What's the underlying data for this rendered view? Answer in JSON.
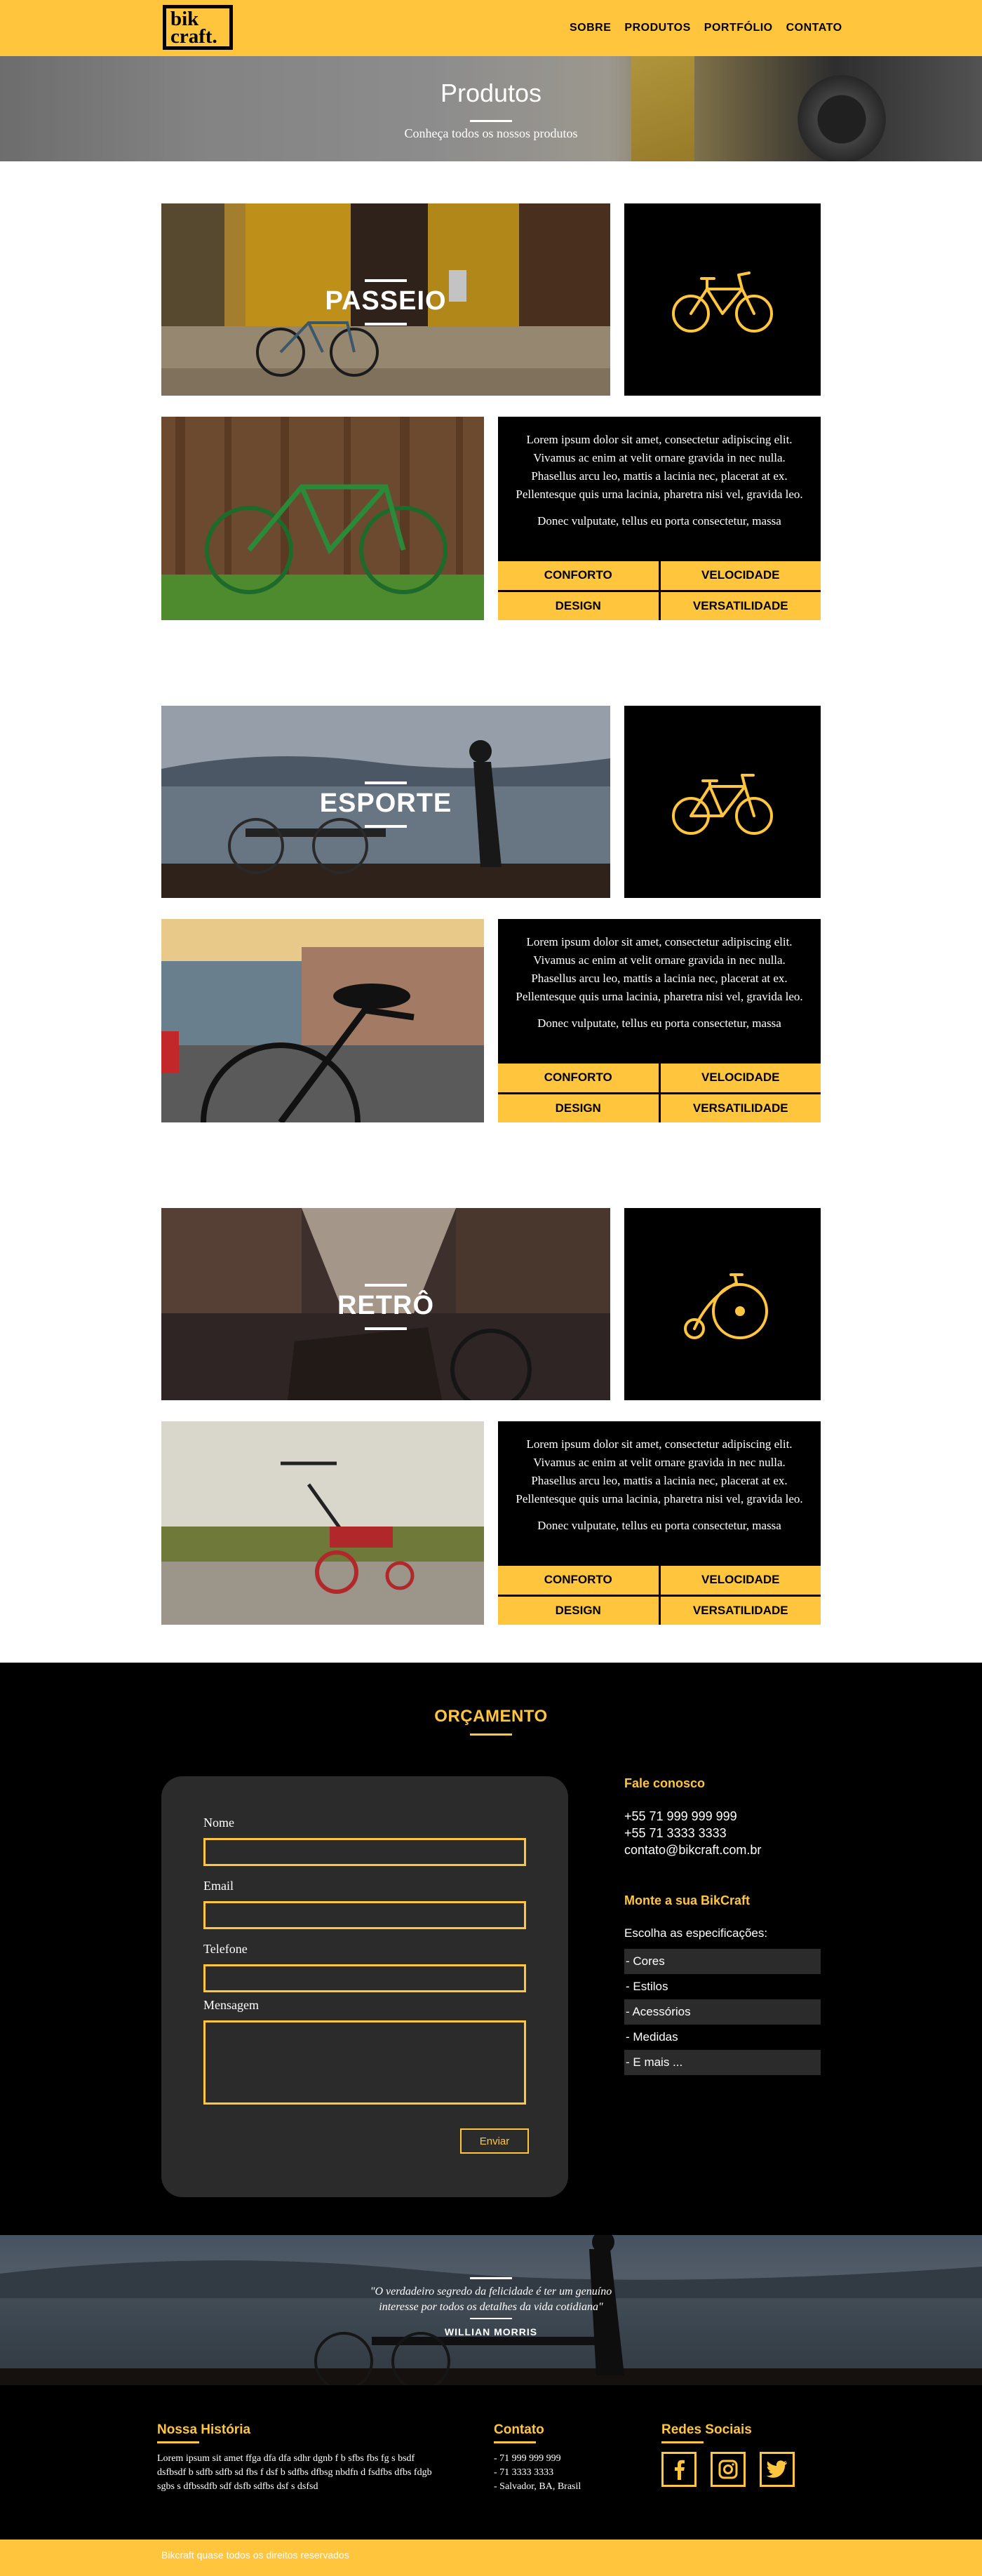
{
  "header": {
    "logo_line1": "bik",
    "logo_line2": "craft.",
    "nav": [
      "SOBRE",
      "PRODUTOS",
      "PORTFÓLIO",
      "CONTATO"
    ]
  },
  "hero": {
    "title": "Produtos",
    "subtitle": "Conheça todos os nossos produtos"
  },
  "products": [
    {
      "name": "PASSEIO",
      "icon": "city-bike-icon",
      "text1": "Lorem ipsum dolor sit amet, consectetur adipiscing elit. Vivamus ac enim at velit ornare gravida in nec nulla. Phasellus arcu leo, mattis a lacinia nec, placerat at ex. Pellentesque quis urna lacinia, pharetra nisi vel, gravida leo.",
      "text2": "Donec vulputate, tellus eu porta consectetur, massa",
      "features": [
        "CONFORTO",
        "VELOCIDADE",
        "DESIGN",
        "VERSATILIDADE"
      ]
    },
    {
      "name": "ESPORTE",
      "icon": "road-bike-icon",
      "text1": "Lorem ipsum dolor sit amet, consectetur adipiscing elit. Vivamus ac enim at velit ornare gravida in nec nulla. Phasellus arcu leo, mattis a lacinia nec, placerat at ex. Pellentesque quis urna lacinia, pharetra nisi vel, gravida leo.",
      "text2": "Donec vulputate, tellus eu porta consectetur, massa",
      "features": [
        "CONFORTO",
        "VELOCIDADE",
        "DESIGN",
        "VERSATILIDADE"
      ]
    },
    {
      "name": "RETRÔ",
      "icon": "penny-farthing-icon",
      "text1": "Lorem ipsum dolor sit amet, consectetur adipiscing elit. Vivamus ac enim at velit ornare gravida in nec nulla. Phasellus arcu leo, mattis a lacinia nec, placerat at ex. Pellentesque quis urna lacinia, pharetra nisi vel, gravida leo.",
      "text2": "Donec vulputate, tellus eu porta consectetur, massa",
      "features": [
        "CONFORTO",
        "VELOCIDADE",
        "DESIGN",
        "VERSATILIDADE"
      ]
    }
  ],
  "budget": {
    "title": "ORÇAMENTO",
    "fields": [
      "Nome",
      "Email",
      "Telefone",
      "Mensagem"
    ],
    "submit": "Enviar",
    "contact_heading": "Fale conosco",
    "phone1": "+55 71 999 999 999",
    "phone2": "+55 71 3333 3333",
    "email": "contato@bikcraft.com.br",
    "build_heading": "Monte a sua BikCraft",
    "build_intro": "Escolha as especificações:",
    "specs": [
      "- Cores",
      "- Estilos",
      "- Acessórios",
      "- Medidas",
      "- E mais ..."
    ]
  },
  "quote": {
    "line1": "\"O verdadeiro segredo da felicidade é ter um genuíno",
    "line2": "interesse por todos os detalhes da vida cotidiana\"",
    "author": "WILLIAN MORRIS"
  },
  "footer": {
    "history_heading": "Nossa História",
    "history_text": "Lorem ipsum sit amet ffga dfa dfa sdhr dgnb f b sfbs fbs fg s bsdf dsfbsdf b sdfb sdfb sd fbs f dsf b sdfbs dfbsg nbdfn d fsdfbs dfbs fdgb sgbs s dfbssdfb sdf dsfb sdfbs dsf s dsfsd",
    "contact_heading": "Contato",
    "contact_lines": [
      "- 71 999 999 999",
      "- 71 3333 3333",
      "- Salvador, BA, Brasil"
    ],
    "social_heading": "Redes Sociais",
    "social_icons": [
      "facebook-icon",
      "instagram-icon",
      "twitter-icon"
    ],
    "copyright": "Bikcraft quase todos os direitos reservados"
  },
  "colors": {
    "accent": "#ffc53d",
    "dark": "#000000",
    "card": "#2b2b2b"
  }
}
